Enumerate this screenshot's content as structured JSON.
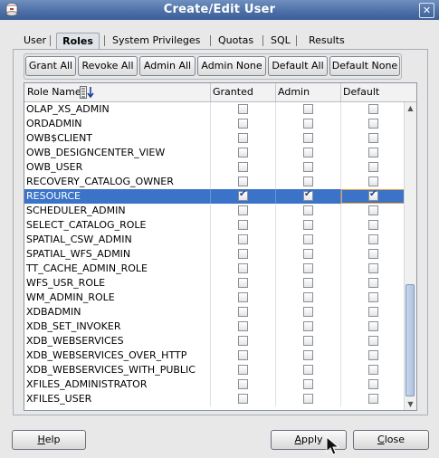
{
  "window": {
    "title": "Create/Edit User"
  },
  "tabs": [
    {
      "label": "User"
    },
    {
      "label": "Roles"
    },
    {
      "label": "System Privileges"
    },
    {
      "label": "Quotas"
    },
    {
      "label": "SQL"
    },
    {
      "label": "Results"
    }
  ],
  "toolbar": {
    "grant_all": "Grant All",
    "revoke_all": "Revoke All",
    "admin_all": "Admin All",
    "admin_none": "Admin None",
    "default_all": "Default All",
    "default_none": "Default None"
  },
  "table": {
    "columns": {
      "role_name": "Role Name",
      "granted": "Granted",
      "admin": "Admin",
      "default": "Default"
    },
    "rows": [
      {
        "name": "OLAP_XS_ADMIN",
        "granted": false,
        "admin": false,
        "default": false
      },
      {
        "name": "ORDADMIN",
        "granted": false,
        "admin": false,
        "default": false
      },
      {
        "name": "OWB$CLIENT",
        "granted": false,
        "admin": false,
        "default": false
      },
      {
        "name": "OWB_DESIGNCENTER_VIEW",
        "granted": false,
        "admin": false,
        "default": false
      },
      {
        "name": "OWB_USER",
        "granted": false,
        "admin": false,
        "default": false
      },
      {
        "name": "RECOVERY_CATALOG_OWNER",
        "granted": false,
        "admin": false,
        "default": false
      },
      {
        "name": "RESOURCE",
        "granted": true,
        "admin": true,
        "default": true,
        "selected": true
      },
      {
        "name": "SCHEDULER_ADMIN",
        "granted": false,
        "admin": false,
        "default": false
      },
      {
        "name": "SELECT_CATALOG_ROLE",
        "granted": false,
        "admin": false,
        "default": false
      },
      {
        "name": "SPATIAL_CSW_ADMIN",
        "granted": false,
        "admin": false,
        "default": false
      },
      {
        "name": "SPATIAL_WFS_ADMIN",
        "granted": false,
        "admin": false,
        "default": false
      },
      {
        "name": "TT_CACHE_ADMIN_ROLE",
        "granted": false,
        "admin": false,
        "default": false
      },
      {
        "name": "WFS_USR_ROLE",
        "granted": false,
        "admin": false,
        "default": false
      },
      {
        "name": "WM_ADMIN_ROLE",
        "granted": false,
        "admin": false,
        "default": false
      },
      {
        "name": "XDBADMIN",
        "granted": false,
        "admin": false,
        "default": false
      },
      {
        "name": "XDB_SET_INVOKER",
        "granted": false,
        "admin": false,
        "default": false
      },
      {
        "name": "XDB_WEBSERVICES",
        "granted": false,
        "admin": false,
        "default": false
      },
      {
        "name": "XDB_WEBSERVICES_OVER_HTTP",
        "granted": false,
        "admin": false,
        "default": false
      },
      {
        "name": "XDB_WEBSERVICES_WITH_PUBLIC",
        "granted": false,
        "admin": false,
        "default": false
      },
      {
        "name": "XFILES_ADMINISTRATOR",
        "granted": false,
        "admin": false,
        "default": false
      },
      {
        "name": "XFILES_USER",
        "granted": false,
        "admin": false,
        "default": false
      }
    ]
  },
  "footer": {
    "help_first": "H",
    "help_rest": "elp",
    "apply_first": "A",
    "apply_rest": "pply",
    "close_first": "C",
    "close_rest": "lose"
  },
  "colors": {
    "selection": "#3a73c8",
    "titlebar": "#4c6ea6",
    "focus_border": "#e8a040"
  },
  "icons": [
    "app-icon",
    "close-icon",
    "sort-icon",
    "scroll-up-icon",
    "scroll-down-icon",
    "mouse-cursor-icon"
  ]
}
